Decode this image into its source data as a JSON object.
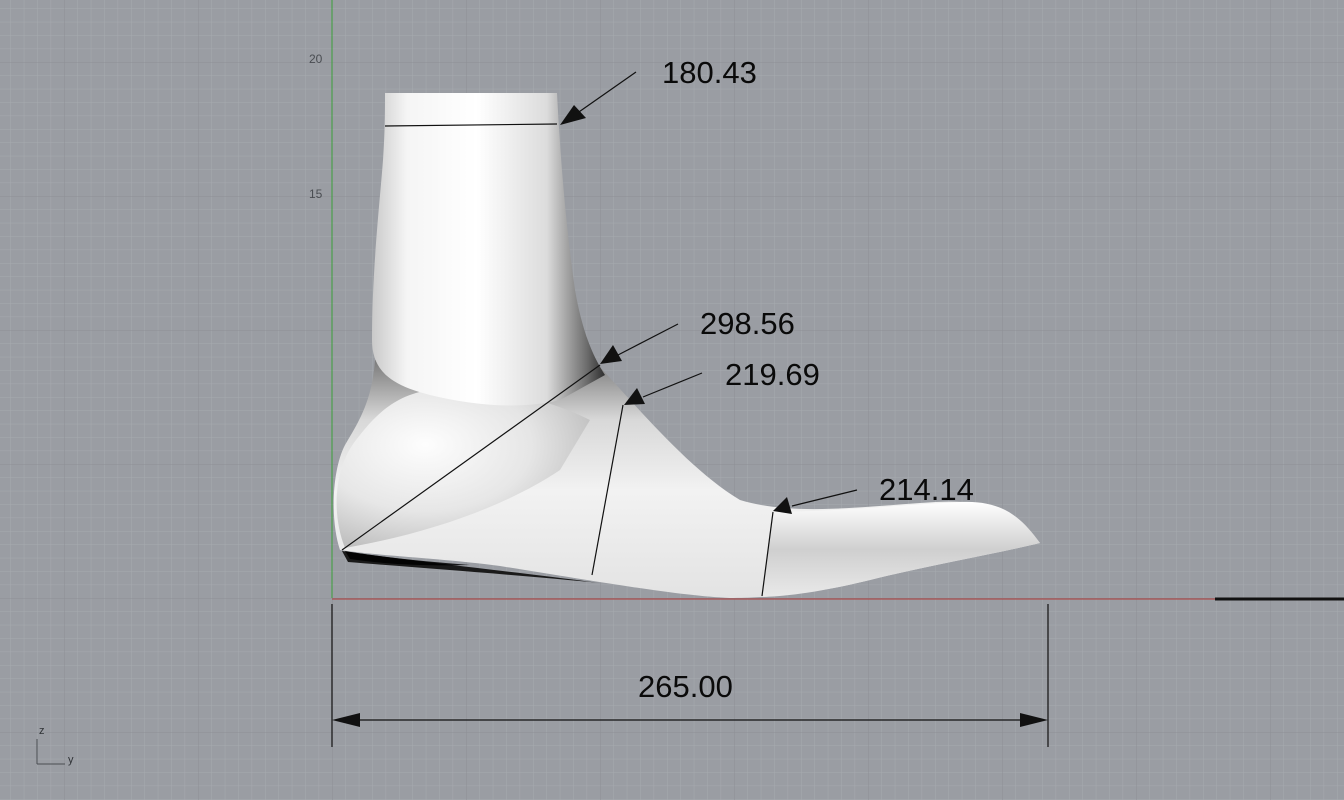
{
  "viewport": {
    "background": "#9a9da3",
    "grid_minor": "#a6a9ae",
    "grid_major": "#8b8e94",
    "x_axis_color": "#b03a3a",
    "y_axis_color": "#3aa03a"
  },
  "ruler": {
    "label_20": "20",
    "label_15": "15"
  },
  "axes": {
    "z_label": "z",
    "y_label": "y"
  },
  "dimensions": {
    "ankle": "180.43",
    "instep": "298.56",
    "waist": "219.69",
    "ball": "214.14",
    "length": "265.00"
  }
}
